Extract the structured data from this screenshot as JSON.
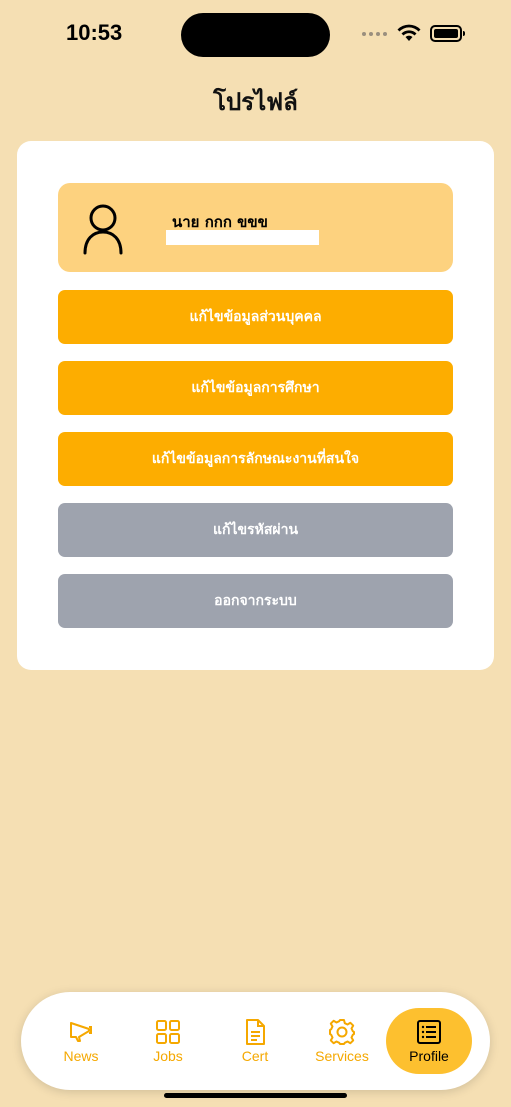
{
  "status_bar": {
    "time": "10:53"
  },
  "header": {
    "title": "โปรไฟล์"
  },
  "profile": {
    "name": "นาย กกก ขขข"
  },
  "actions": [
    {
      "label": "แก้ไขข้อมูลส่วนบุคคล",
      "color": "#FDAD00"
    },
    {
      "label": "แก้ไขข้อมูลการศึกษา",
      "color": "#FDAD00"
    },
    {
      "label": "แก้ไขข้อมูลการลักษณะงานที่สนใจ",
      "color": "#FDAD00"
    },
    {
      "label": "แก้ไขรหัสผ่าน",
      "color": "#9EA3AE"
    },
    {
      "label": "ออกจากระบบ",
      "color": "#9EA3AE"
    }
  ],
  "tabs": [
    {
      "label": "News",
      "icon": "megaphone-icon"
    },
    {
      "label": "Jobs",
      "icon": "grid-icon"
    },
    {
      "label": "Cert",
      "icon": "document-icon"
    },
    {
      "label": "Services",
      "icon": "gear-icon"
    },
    {
      "label": "Profile",
      "icon": "list-icon",
      "active": true
    }
  ],
  "colors": {
    "background": "#F5DFB3",
    "accent": "#FDAD00",
    "profile_box": "#FDD27F",
    "active_tab": "#FDC02F",
    "muted_button": "#9EA3AE"
  }
}
